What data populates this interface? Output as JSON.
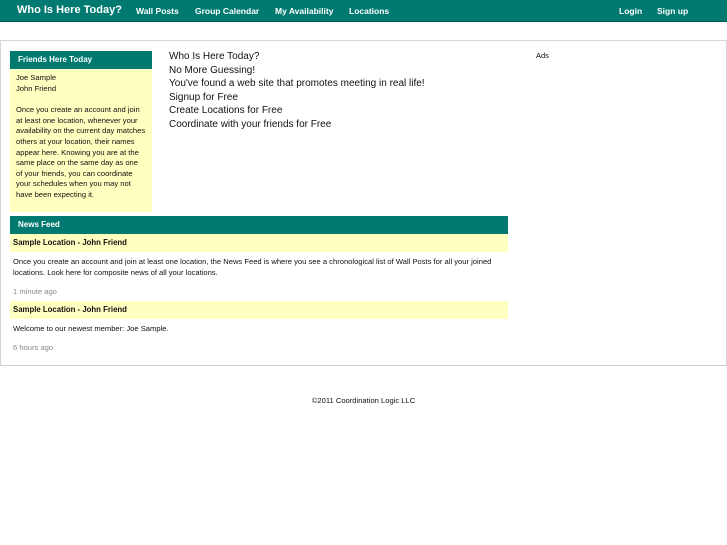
{
  "nav": {
    "brand": "Who Is Here Today?",
    "links": [
      "Wall Posts",
      "Group Calendar",
      "My Availability",
      "Locations"
    ],
    "login": "Login",
    "signup": "Sign up"
  },
  "friends_panel": {
    "title": "Friends Here Today",
    "friends": [
      "Joe Sample",
      "John Friend"
    ],
    "description": "Once you create an account and join at least one location, whenever your availability on the current day matches others at your location, their names appear here. Knowing you are at the same place on the same day as one of your friends, you can coordinate your schedules when you may not have been expecting it."
  },
  "intro": {
    "lines": [
      "Who Is Here Today?",
      "No More Guessing!",
      "You've found a web site that promotes meeting in real life!",
      "Signup for Free",
      "Create Locations for Free",
      "Coordinate with your friends for Free"
    ]
  },
  "ads": {
    "label": "Ads"
  },
  "news_feed": {
    "title": "News Feed",
    "items": [
      {
        "heading": "Sample Location - John Friend",
        "text": "Once you create an account and join at least one location, the News Feed is where you see a chronological list of Wall Posts for all your joined locations. Look here for composite news of all your locations.",
        "time": "1 minute ago"
      },
      {
        "heading": "Sample Location - John Friend",
        "text": "Welcome to our newest member: Joe Sample.",
        "time": "6 hours ago"
      }
    ]
  },
  "footer": {
    "text": "©2011 Coordination Logic LLC"
  }
}
